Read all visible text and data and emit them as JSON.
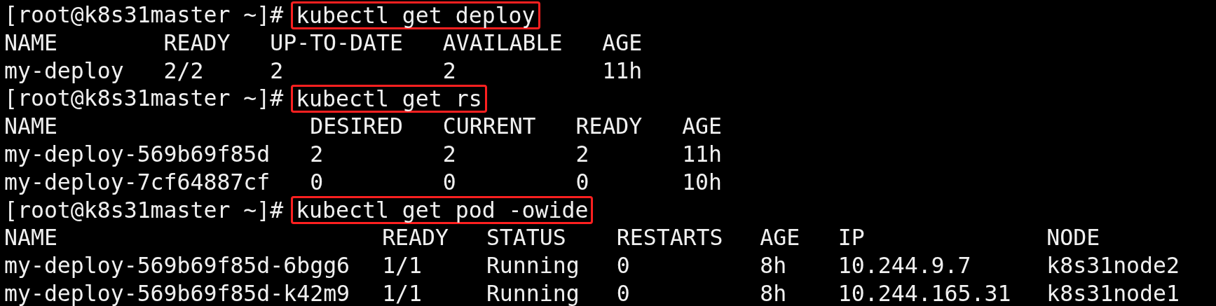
{
  "blocks": [
    {
      "kind": "command",
      "prompt": "[root@k8s31master ~]#",
      "command": "kubectl get deploy",
      "highlighted": true
    },
    {
      "kind": "table",
      "columns": [
        "NAME",
        "READY",
        "UP-TO-DATE",
        "AVAILABLE",
        "AGE"
      ],
      "rows": [
        [
          "my-deploy",
          "2/2",
          "2",
          "2",
          "11h"
        ]
      ]
    },
    {
      "kind": "command",
      "prompt": "[root@k8s31master ~]#",
      "command": "kubectl get rs",
      "highlighted": true
    },
    {
      "kind": "table",
      "columns": [
        "NAME",
        "DESIRED",
        "CURRENT",
        "READY",
        "AGE"
      ],
      "rows": [
        [
          "my-deploy-569b69f85d",
          "2",
          "2",
          "2",
          "11h"
        ],
        [
          "my-deploy-7cf64887cf",
          "0",
          "0",
          "0",
          "10h"
        ]
      ]
    },
    {
      "kind": "command",
      "prompt": "[root@k8s31master ~]#",
      "command": "kubectl get pod -owide",
      "highlighted": true
    },
    {
      "kind": "table",
      "columns": [
        "NAME",
        "READY",
        "STATUS",
        "RESTARTS",
        "AGE",
        "IP",
        "NODE"
      ],
      "rows": [
        [
          "my-deploy-569b69f85d-6bgg6",
          "1/1",
          "Running",
          "0",
          "8h",
          "10.244.9.7",
          "k8s31node2"
        ],
        [
          "my-deploy-569b69f85d-k42m9",
          "1/1",
          "Running",
          "0",
          "8h",
          "10.244.165.31",
          "k8s31node1"
        ]
      ]
    }
  ]
}
